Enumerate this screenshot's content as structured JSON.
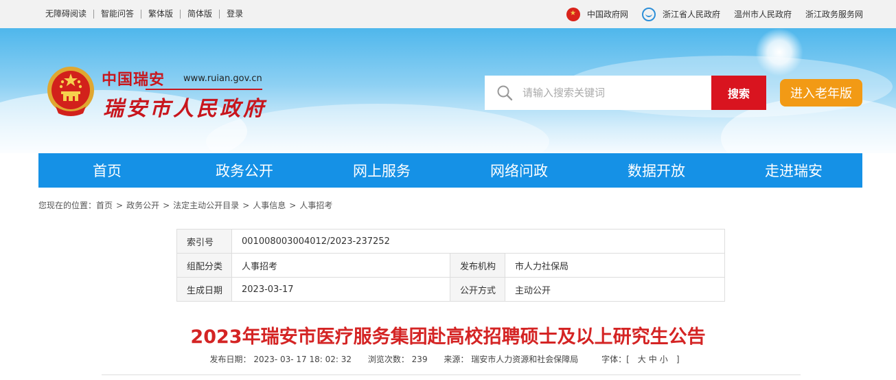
{
  "topbar": {
    "left_links": [
      "无障碍阅读",
      "智能问答",
      "繁体版",
      "简体版",
      "登录"
    ],
    "right_links": [
      {
        "label": "中国政府网",
        "icon": "national-emblem-icon"
      },
      {
        "label": "浙江省人民政府",
        "icon": "zhejiang-gov-icon"
      },
      {
        "label": "温州市人民政府",
        "icon": ""
      },
      {
        "label": "浙江政务服务网",
        "icon": ""
      }
    ]
  },
  "header": {
    "title_small": "中国瑞安",
    "url": "www.ruian.gov.cn",
    "title_main": "瑞安市人民政府",
    "search_placeholder": "请输入搜索关键词",
    "search_button": "搜索",
    "elder_button": "进入老年版"
  },
  "nav": {
    "items": [
      "首页",
      "政务公开",
      "网上服务",
      "网络问政",
      "数据开放",
      "走进瑞安"
    ]
  },
  "breadcrumb": {
    "prefix": "您现在的位置：",
    "items": [
      "首页",
      "政务公开",
      "法定主动公开目录",
      "人事信息",
      "人事招考"
    ]
  },
  "info": {
    "index_label": "索引号",
    "index_value": "001008003004012/2023-237252",
    "category_label": "组配分类",
    "category_value": "人事招考",
    "publisher_label": "发布机构",
    "publisher_value": "市人力社保局",
    "date_label": "生成日期",
    "date_value": "2023-03-17",
    "method_label": "公开方式",
    "method_value": "主动公开"
  },
  "article": {
    "title": "2023年瑞安市医疗服务集团赴高校招聘硕士及以上研究生公告",
    "publish_date": "发布日期： 2023- 03- 17 18: 02: 32",
    "views": "浏览次数： 239",
    "source": "来源： 瑞安市人力资源和社会保障局",
    "font_label": "字体：[",
    "font_large": "大",
    "font_medium": "中",
    "font_small": "小",
    "font_close": "]"
  },
  "colors": {
    "nav_blue": "#1591e6",
    "brand_red": "#c8161d",
    "search_red": "#d9141f",
    "elder_orange": "#f29a15",
    "title_red": "#d42424"
  }
}
